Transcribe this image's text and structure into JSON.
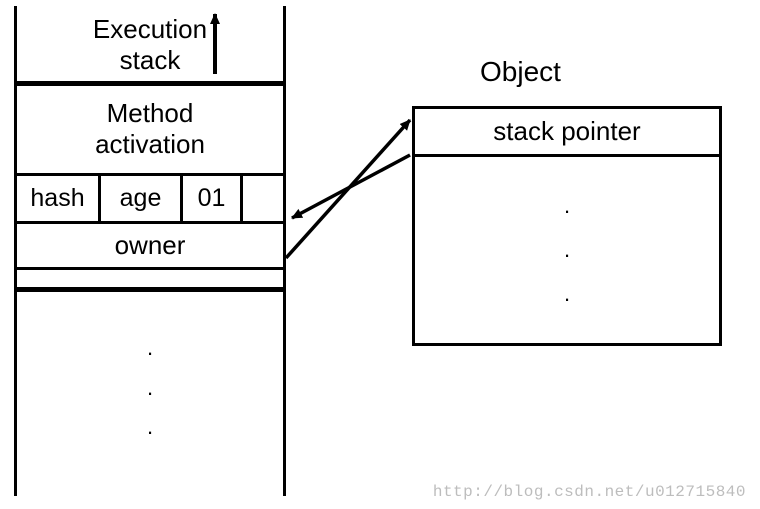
{
  "stack": {
    "title_line1": "Execution",
    "title_line2": "stack",
    "method_line1": "Method",
    "method_line2": "activation",
    "fields": {
      "hash": "hash",
      "age": "age",
      "bits": "01"
    },
    "owner": "owner",
    "dots": "."
  },
  "object": {
    "label": "Object",
    "header": "stack pointer",
    "dots": "."
  },
  "footer": {
    "watermark": "http://blog.csdn.net/u012715840"
  }
}
